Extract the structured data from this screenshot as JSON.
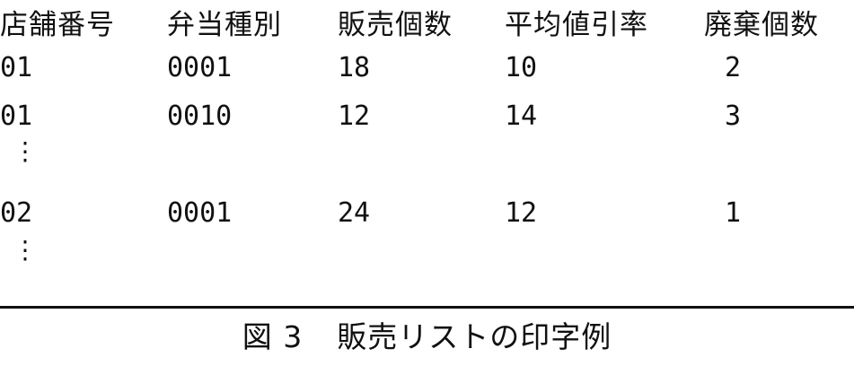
{
  "table": {
    "headers": [
      "店舗番号",
      "弁当種別",
      "販売個数",
      "平均値引率",
      "廃棄個数"
    ],
    "rows": [
      [
        "01",
        "0001",
        "18",
        "10",
        "2"
      ],
      [
        "01",
        "0010",
        "12",
        "14",
        "3"
      ],
      [
        "02",
        "0001",
        "24",
        "12",
        "1"
      ]
    ],
    "continuation_mark": "⋮"
  },
  "caption": {
    "figure_number": "図 3",
    "title": "販売リストの印字例"
  }
}
